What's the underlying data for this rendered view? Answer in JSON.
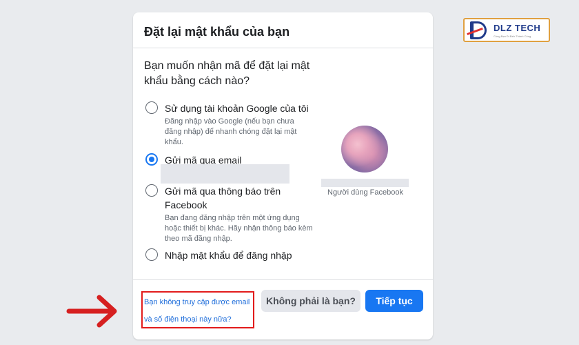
{
  "card": {
    "title": "Đặt lại mật khẩu của bạn",
    "question": "Bạn muốn nhận mã để đặt lại mật khẩu bằng cách nào?",
    "options": [
      {
        "label": "Sử dụng tài khoản Google của tôi",
        "description": "Đăng nhập vào Google (nếu bạn chưa đăng nhập) để nhanh chóng đặt lại mật khẩu.",
        "checked": false
      },
      {
        "label": "Gửi mã qua email",
        "description": "",
        "checked": true
      },
      {
        "label": "Gửi mã qua thông báo trên Facebook",
        "description": "Bạn đang đăng nhập trên một ứng dụng hoặc thiết bị khác. Hãy nhận thông báo kèm theo mã đăng nhập.",
        "checked": false
      },
      {
        "label": "Nhập mật khẩu để đăng nhập",
        "description": "",
        "checked": false
      }
    ],
    "user_caption": "Người dùng Facebook",
    "help_link_line1": "Bạn không truy cập được email",
    "help_link_line2": "và số điện thoại này nữa?",
    "not_you_button": "Không phải là bạn?",
    "continue_button": "Tiếp tục"
  },
  "logo": {
    "name": "DLZ TECH",
    "tagline": "Cùng Bạn Đi Đến Thành Công"
  },
  "colors": {
    "accent": "#1877f2",
    "highlight": "#e21b1b",
    "background": "#e9ebee"
  },
  "icons": [
    "radio-button",
    "arrow-right-icon",
    "avatar"
  ]
}
